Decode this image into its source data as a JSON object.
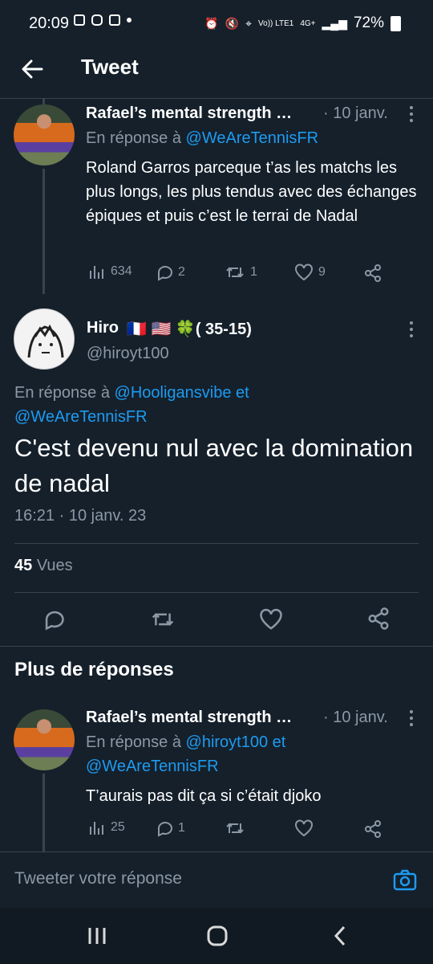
{
  "status_bar": {
    "time": "20:09",
    "network": "Vo)) LTE1",
    "signal_label": "4G+",
    "battery": "72%"
  },
  "header": {
    "title": "Tweet"
  },
  "parent_tweet": {
    "author": "Rafael’s mental strength …",
    "date": "· 10 janv.",
    "reply_prefix": "En réponse à ",
    "reply_to": "@WeAreTennisFR",
    "text": "Roland Garros parceque t’as les matchs les plus longs, les plus tendus avec des échanges épiques et puis c’est le terrai de Nadal",
    "views": "634",
    "replies": "2",
    "retweets": "1",
    "likes": "9"
  },
  "main_tweet": {
    "author": "Hiro",
    "badges": "🇫🇷 🇺🇸 🍀( 35-15)",
    "handle": "@hiroyt100",
    "reply_prefix": "En réponse à ",
    "reply_to_1": "@Hooligansvibe",
    "reply_and": " et",
    "reply_to_2": "@WeAreTennisFR",
    "text": "C'est devenu nul avec la domination de nadal",
    "timestamp": "16:21 · 10 janv. 23",
    "views_count": "45",
    "views_label": "Vues"
  },
  "more_replies": {
    "heading": "Plus de réponses"
  },
  "reply_tweet": {
    "author": "Rafael’s mental strength …",
    "date": "· 10 janv.",
    "reply_prefix": "En réponse à ",
    "reply_to_1": "@hiroyt100",
    "reply_and": " et",
    "reply_to_2": "@WeAreTennisFR",
    "text": "T’aurais pas dit ça si c’était djoko",
    "views": "25",
    "replies": "1"
  },
  "composer": {
    "placeholder": "Tweeter votre réponse"
  },
  "icons": [
    "back-arrow-icon",
    "views-icon",
    "reply-icon",
    "retweet-icon",
    "like-icon",
    "share-icon",
    "more-icon",
    "camera-icon",
    "recents-icon",
    "home-icon",
    "back-nav-icon"
  ],
  "colors": {
    "background": "#15202b",
    "link": "#1d9bf0",
    "muted": "#8b98a5",
    "divider": "#38444d"
  }
}
